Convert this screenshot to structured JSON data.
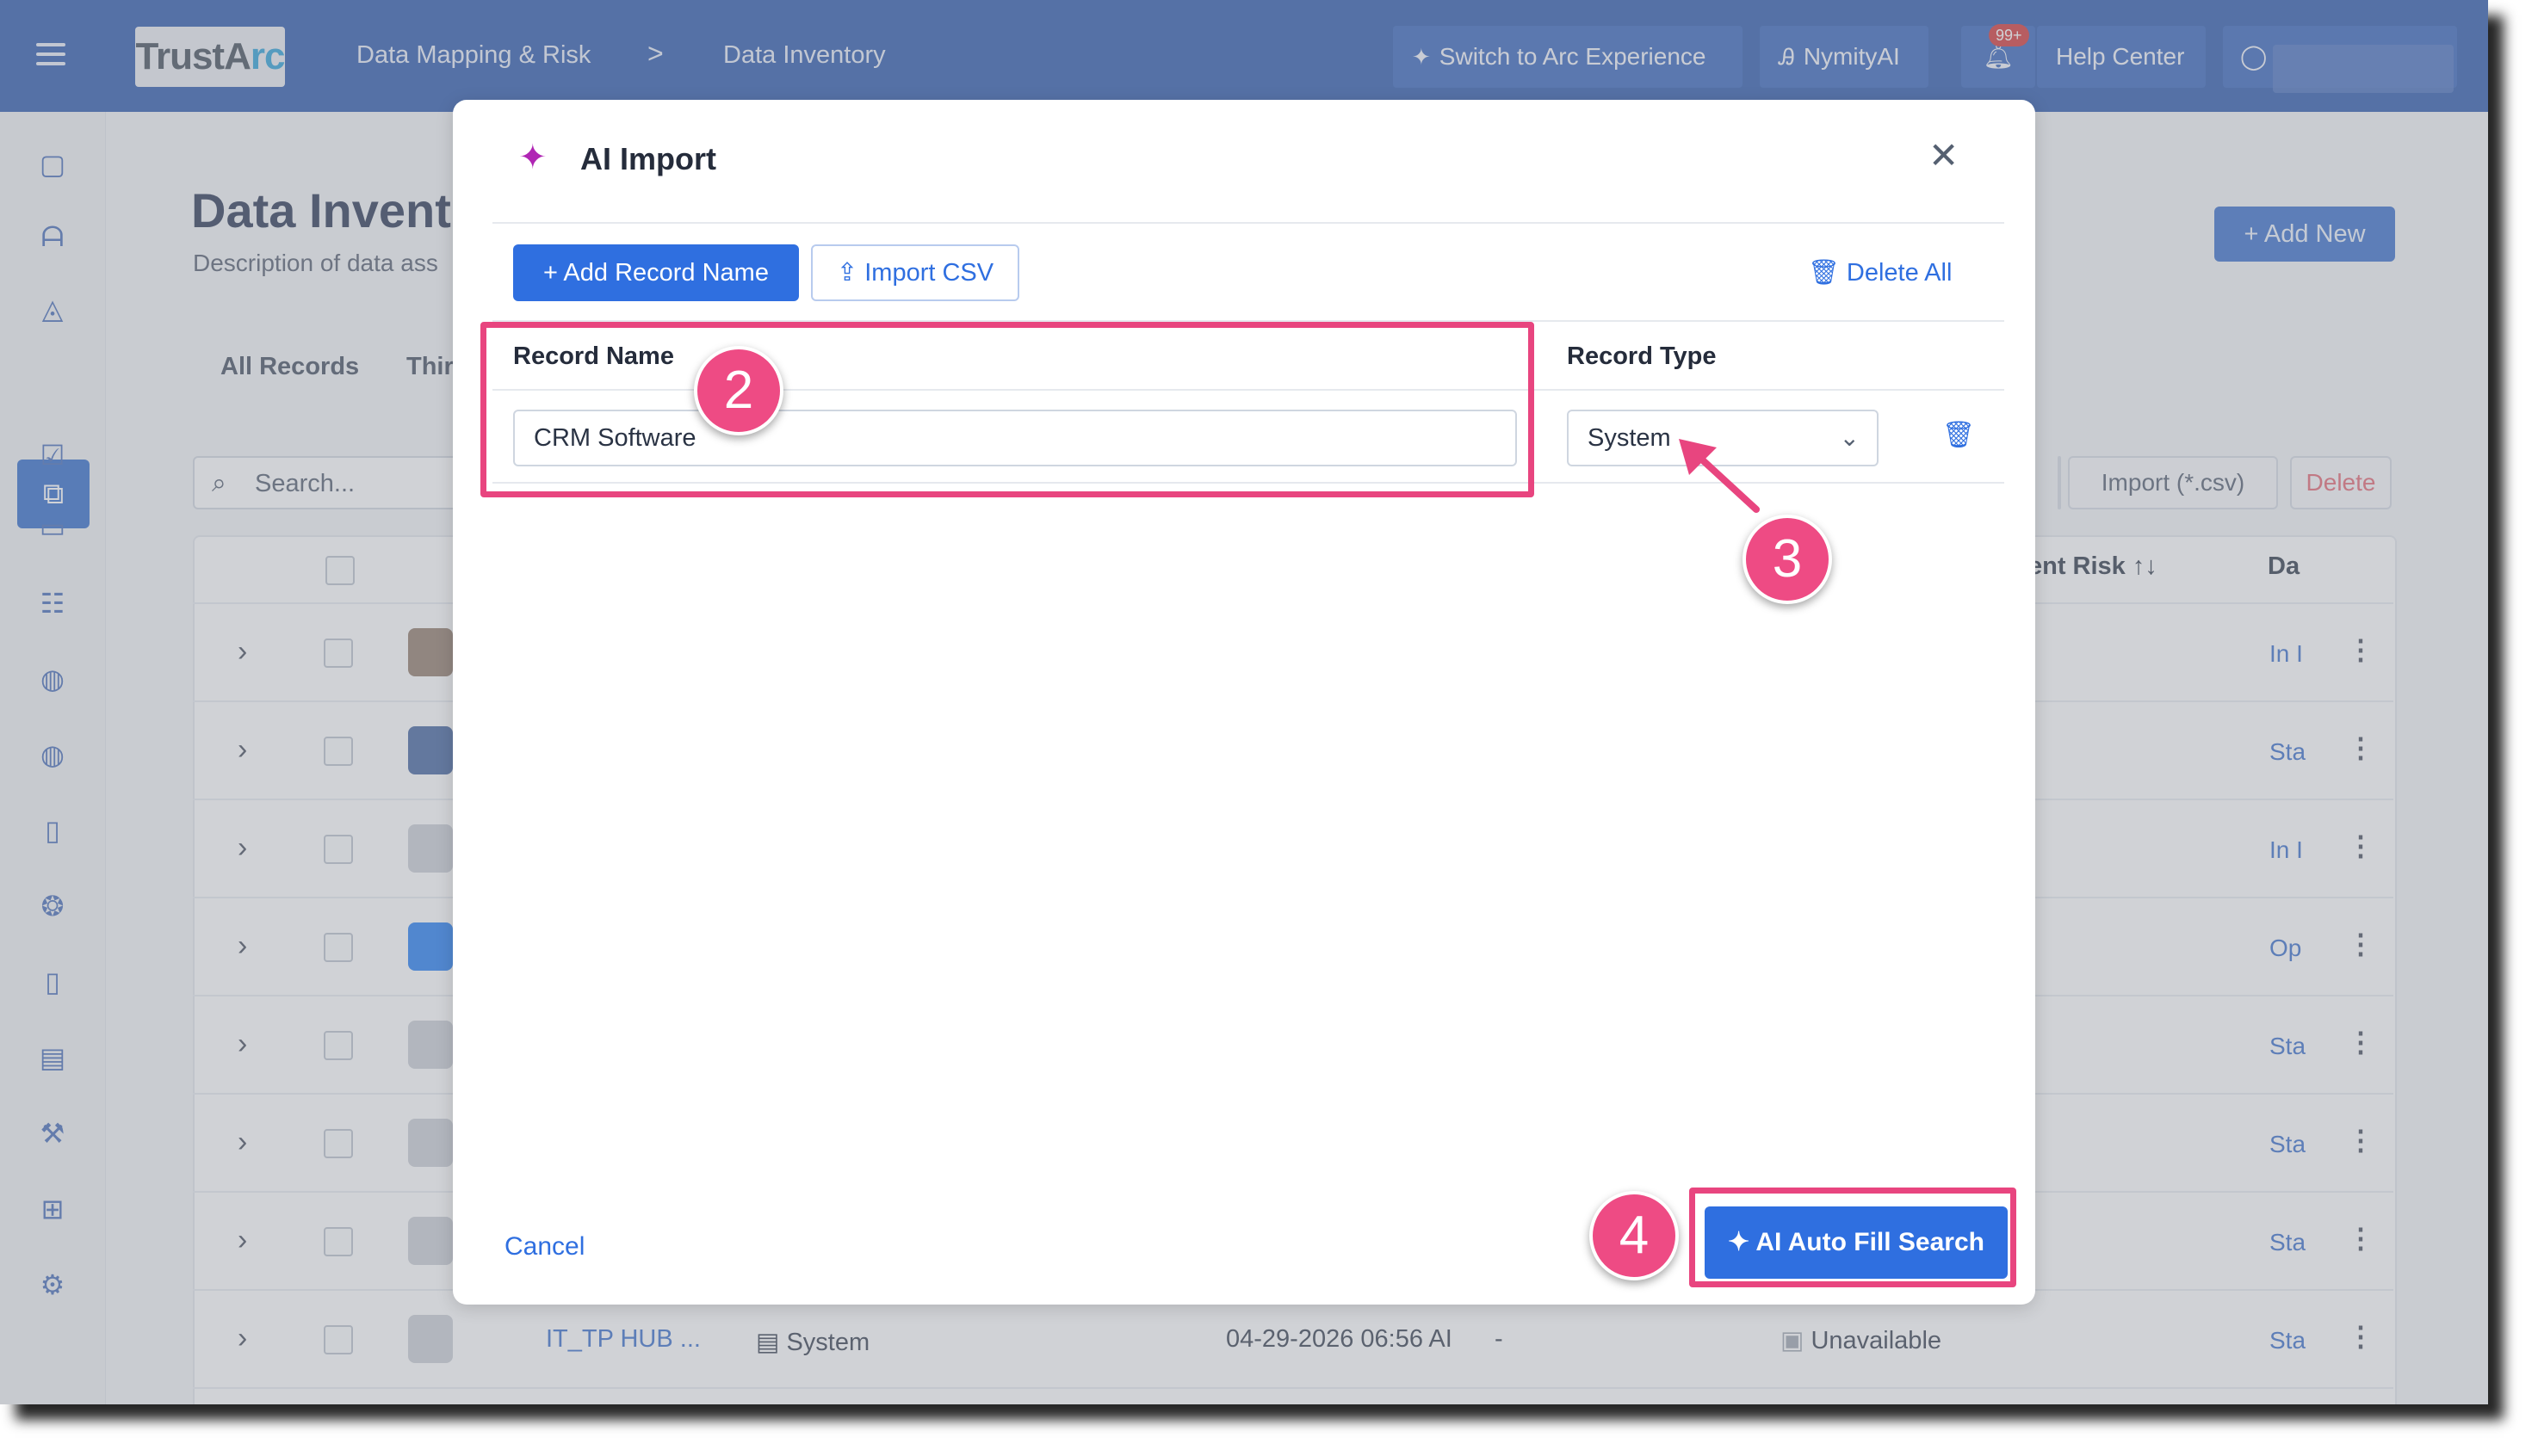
{
  "topbar": {
    "menu_icon": "hamburger-icon",
    "logo_text_a": "TrustA",
    "logo_text_b": "rc",
    "breadcrumb": [
      "Data Mapping & Risk",
      "Data Inventory"
    ],
    "breadcrumb_sep": ">",
    "switch_label": "Switch to Arc Experience",
    "nymity_label": "NymityAI",
    "notif_badge": "99+",
    "help_label": "Help Center"
  },
  "sidebar": {
    "icons": [
      "report-icon",
      "chart-icon",
      "bell-icon",
      "network-icon",
      "clipboard-check-icon",
      "monitor-icon",
      "list-person-icon",
      "globe-icon",
      "globe-alt-icon",
      "file-search-icon",
      "brain-icon",
      "file-clock-icon",
      "file-chart-icon",
      "gavel-icon",
      "flow-icon",
      "gear-icon"
    ]
  },
  "page": {
    "title": "Data Invento",
    "description": "Description of data ass",
    "tabs": [
      "All Records",
      "Thir"
    ],
    "search_placeholder": "Search...",
    "add_new": "+ Add New",
    "import_label": "Import (*.csv)",
    "delete_label": "Delete",
    "col_risk": "ent Risk ↑↓",
    "col_da": "Da",
    "row_status": [
      "In I",
      "Sta",
      "In I",
      "Op",
      "Sta",
      "Sta",
      "Sta",
      "Sta"
    ],
    "last_row": {
      "name": "IT_TP HUB ...",
      "type": "System",
      "date": "04-29-2026 06:56 AI",
      "dash": "-",
      "availability": "Unavailable",
      "status": "Sta"
    }
  },
  "modal": {
    "title": "AI Import",
    "add_record": "+ Add Record Name",
    "import_csv": "Import CSV",
    "delete_all": "Delete All",
    "col_record_name": "Record Name",
    "col_record_type": "Record Type",
    "record_name_value": "CRM Software",
    "record_type_value": "System",
    "cancel": "Cancel",
    "ai_fill": "AI Auto Fill Search"
  },
  "annotations": [
    "2",
    "3",
    "4"
  ],
  "colors": {
    "topbar": "#1f4fa8",
    "primary": "#2f6fe0",
    "highlight": "#e8457f",
    "accent_spark": "#b026b4"
  }
}
